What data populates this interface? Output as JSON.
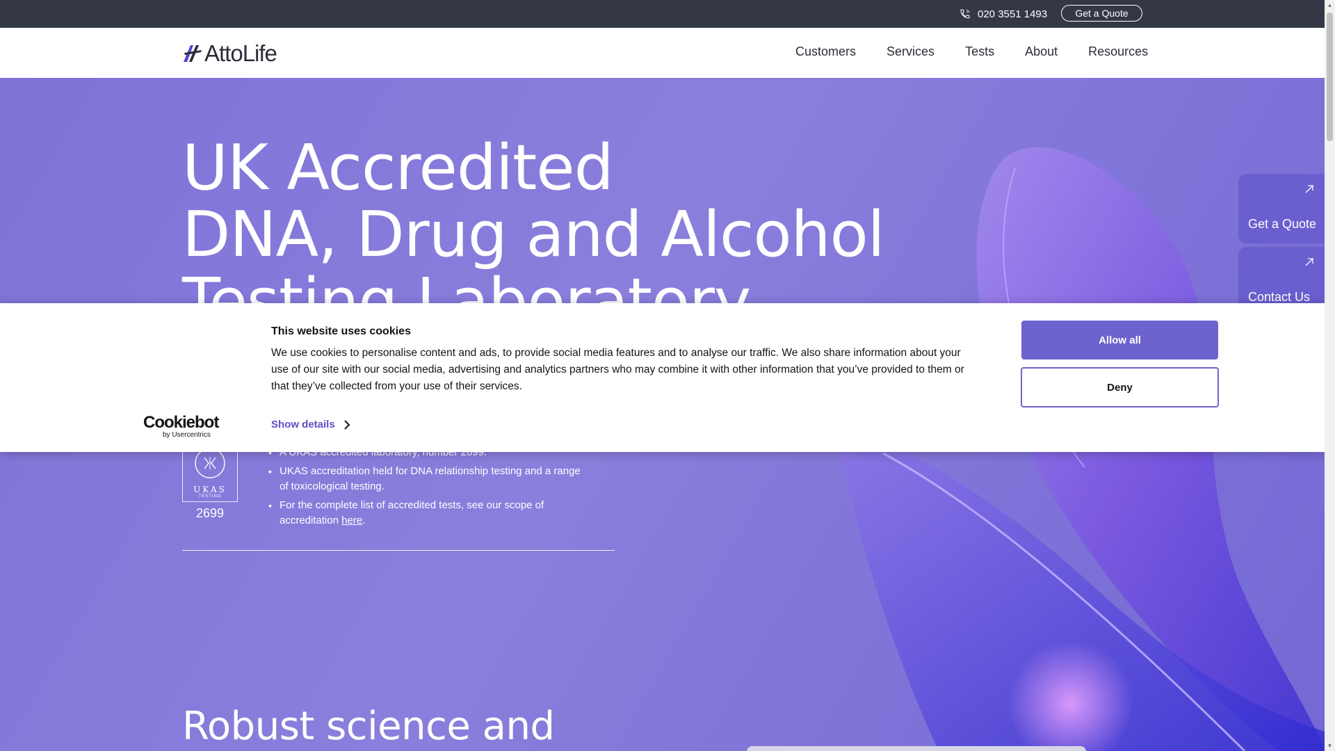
{
  "topbar": {
    "phone": "020 3551 1493",
    "quote_label": "Get a Quote"
  },
  "nav": {
    "logo_text": "AttoLife",
    "links": [
      "Customers",
      "Services",
      "Tests",
      "About",
      "Resources"
    ]
  },
  "hero": {
    "title_lines": [
      "UK Accredited",
      "DNA, Drug and Alcohol",
      "Testing Laboratory"
    ],
    "ukas_badge": {
      "word": "UKAS",
      "sub": "TESTING",
      "number": "2699"
    },
    "bullets": [
      "A UKAS accredited laboratory, number 2699.",
      "UKAS accreditation held for DNA relationship testing and a range of toxicological testing."
    ],
    "bullet3_prefix": "For the complete list of accredited tests, see our scope of accreditation ",
    "bullet3_link": "here",
    "bullet3_suffix": ".",
    "subheading": "Robust science and"
  },
  "side_tabs": {
    "quote": "Get a Quote",
    "contact": "Contact Us"
  },
  "cookie": {
    "title": "This website uses cookies",
    "body": "We use cookies to personalise content and ads, to provide social media features and to analyse our traffic. We also share information about your use of our site with our social media, advertising and analytics partners who may combine it with other information that you’ve provided to them or that they’ve collected from your use of their services.",
    "show_details": "Show details",
    "allow_all": "Allow all",
    "deny": "Deny",
    "logo_main": "Cookiebot",
    "logo_by": "by Usercentrics"
  },
  "colors": {
    "topbar_bg": "#343845",
    "hero_bg": "#7f73d8",
    "accent": "#6d63cf",
    "side_tab_bg": "#6a5fcf"
  }
}
